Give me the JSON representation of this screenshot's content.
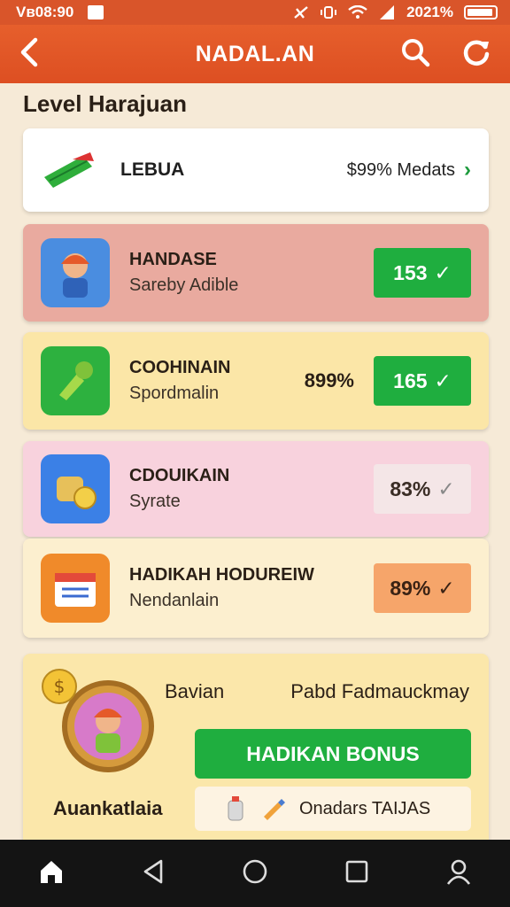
{
  "status_bar": {
    "time": "Vв08:90",
    "battery_text": "2021%"
  },
  "app_bar": {
    "title": "NADAL.AN"
  },
  "section": {
    "title": "Level Harajuan"
  },
  "first_item": {
    "name": "LEBUA",
    "value": "$99% Medats"
  },
  "items": [
    {
      "name": "HANDASE",
      "sub": "Sareby Adible",
      "percent": "",
      "badge": "153",
      "badge_style": "green"
    },
    {
      "name": "COOHINAIN",
      "sub": "Spordmalin",
      "percent": "899%",
      "badge": "165",
      "badge_style": "green"
    },
    {
      "name": "CDOUIKAIN",
      "sub": "Syrate",
      "percent": "",
      "badge": "83%",
      "badge_style": "light"
    },
    {
      "name": "HADIKAH HODUREIW",
      "sub": "Nendanlain",
      "percent": "",
      "badge": "89%",
      "badge_style": "orange"
    }
  ],
  "bonus": {
    "label_left": "Bavian",
    "label_right": "Pabd Fadmauckmay",
    "button": "HADIKAN BONUS",
    "info": "Onadars TAIJAS",
    "title": "Auankatlaia"
  },
  "colors": {
    "accent": "#dd4f22",
    "green": "#1fae3f"
  }
}
